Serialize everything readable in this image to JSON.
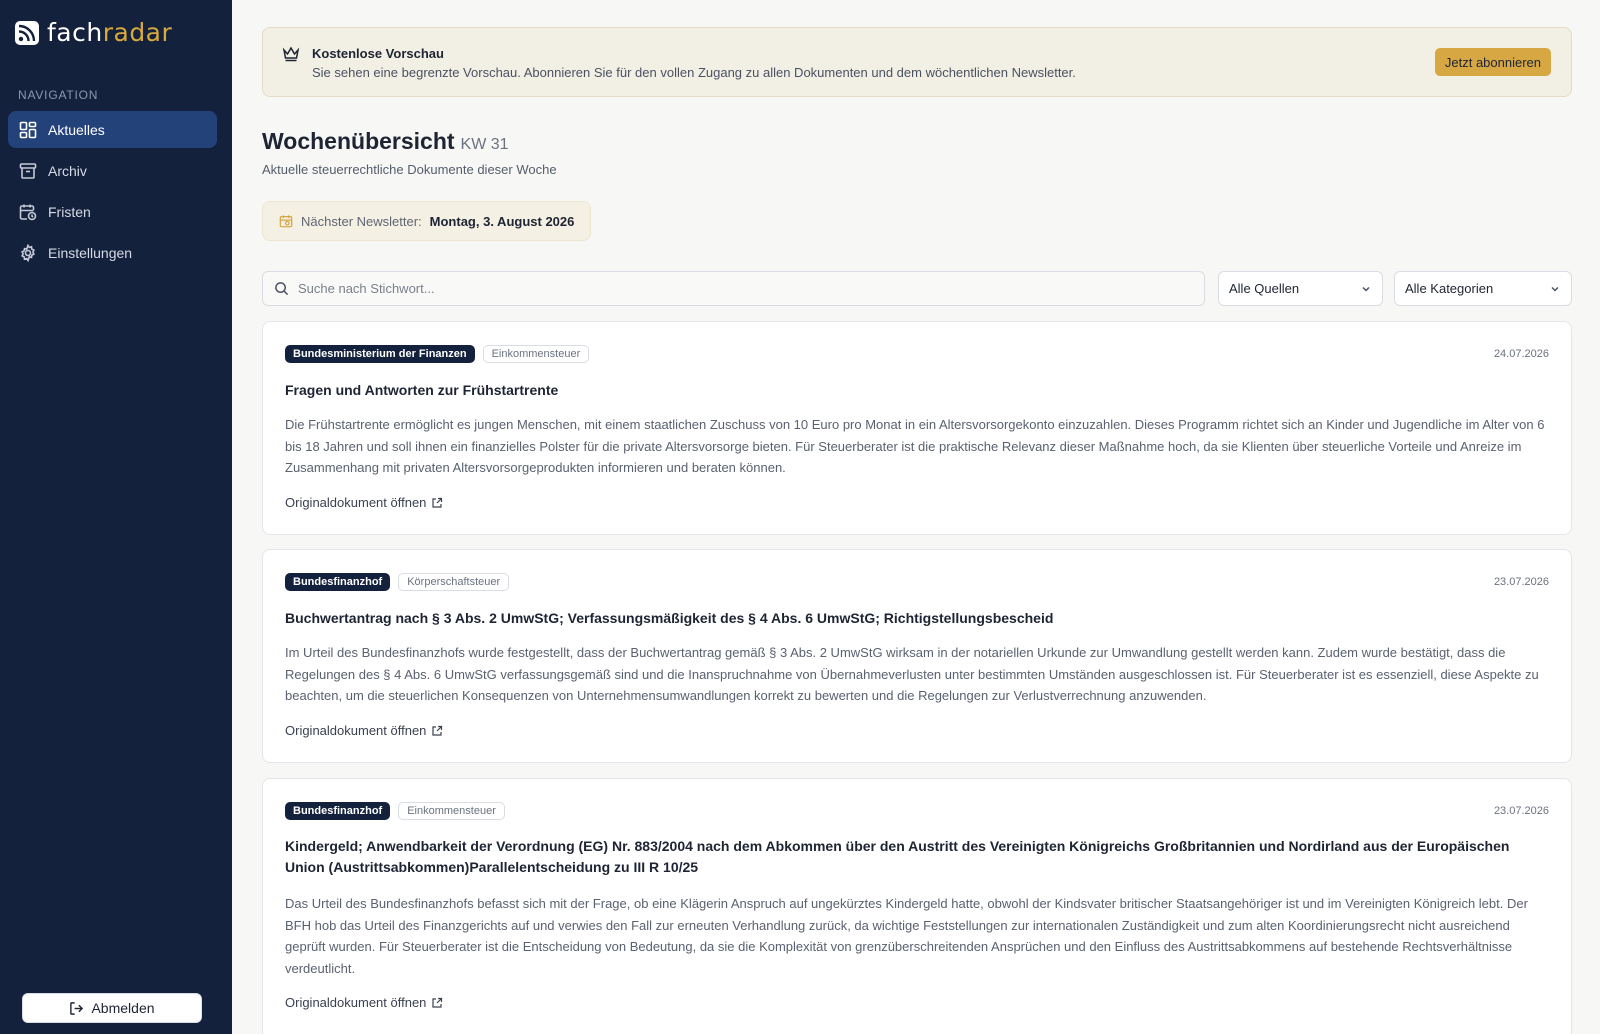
{
  "brand": {
    "name_part1": "fach",
    "name_part2": "radar"
  },
  "sidebar": {
    "heading": "NAVIGATION",
    "items": [
      {
        "label": "Aktuelles",
        "icon": "dashboard-icon",
        "active": true
      },
      {
        "label": "Archiv",
        "icon": "archive-icon",
        "active": false
      },
      {
        "label": "Fristen",
        "icon": "calendar-clock-icon",
        "active": false
      },
      {
        "label": "Einstellungen",
        "icon": "gear-icon",
        "active": false
      }
    ],
    "logout_label": "Abmelden"
  },
  "banner": {
    "icon": "crown-icon",
    "title": "Kostenlose Vorschau",
    "text": "Sie sehen eine begrenzte Vorschau. Abonnieren Sie für den vollen Zugang zu allen Dokumenten und dem wöchentlichen Newsletter.",
    "button_label": "Jetzt abonnieren"
  },
  "page": {
    "title": "Wochenübersicht",
    "week": "KW 31",
    "subtitle": "Aktuelle steuerrechtliche Dokumente dieser Woche"
  },
  "newsletter": {
    "label": "Nächster Newsletter:",
    "date": "Montag, 3. August 2026"
  },
  "filters": {
    "search_placeholder": "Suche nach Stichwort...",
    "source_selected": "Alle Quellen",
    "category_selected": "Alle Kategorien"
  },
  "documents": [
    {
      "source": "Bundesministerium der Finanzen",
      "category": "Einkommensteuer",
      "date": "24.07.2026",
      "title": "Fragen und Antworten zur Frühstartrente",
      "summary": "Die Frühstartrente ermöglicht es jungen Menschen, mit einem staatlichen Zuschuss von 10 Euro pro Monat in ein Altersvorsorgekonto einzuzahlen. Dieses Programm richtet sich an Kinder und Jugendliche im Alter von 6 bis 18 Jahren und soll ihnen ein finanzielles Polster für die private Altersvorsorge bieten. Für Steuerberater ist die praktische Relevanz dieser Maßnahme hoch, da sie Klienten über steuerliche Vorteile und Anreize im Zusammenhang mit privaten Altersvorsorgeprodukten informieren und beraten können.",
      "link_label": "Originaldokument öffnen"
    },
    {
      "source": "Bundesfinanzhof",
      "category": "Körperschaftsteuer",
      "date": "23.07.2026",
      "title": "Buchwertantrag nach § 3 Abs. 2 UmwStG; Verfassungsmäßigkeit des § 4 Abs. 6 UmwStG; Richtigstellungsbescheid",
      "summary": "Im Urteil des Bundesfinanzhofs wurde festgestellt, dass der Buchwertantrag gemäß § 3 Abs. 2 UmwStG wirksam in der notariellen Urkunde zur Umwandlung gestellt werden kann. Zudem wurde bestätigt, dass die Regelungen des § 4 Abs. 6 UmwStG verfassungsgemäß sind und die Inanspruchnahme von Übernahmeverlusten unter bestimmten Umständen ausgeschlossen ist. Für Steuerberater ist es essenziell, diese Aspekte zu beachten, um die steuerlichen Konsequenzen von Unternehmensumwandlungen korrekt zu bewerten und die Regelungen zur Verlustverrechnung anzuwenden.",
      "link_label": "Originaldokument öffnen"
    },
    {
      "source": "Bundesfinanzhof",
      "category": "Einkommensteuer",
      "date": "23.07.2026",
      "title": "Kindergeld; Anwendbarkeit der Verordnung (EG) Nr. 883/2004 nach dem Abkommen über den Austritt des Vereinigten Königreichs Großbritannien und Nordirland aus der Europäischen Union (Austrittsabkommen)Parallelentscheidung zu III R 10/25",
      "summary": "Das Urteil des Bundesfinanzhofs befasst sich mit der Frage, ob eine Klägerin Anspruch auf ungekürztes Kindergeld hatte, obwohl der Kindsvater britischer Staatsangehöriger ist und im Vereinigten Königreich lebt. Der BFH hob das Urteil des Finanzgerichts auf und verwies den Fall zur erneuten Verhandlung zurück, da wichtige Feststellungen zur internationalen Zuständigkeit und zum alten Koordinierungsrecht nicht ausreichend geprüft wurden. Für Steuerberater ist die Entscheidung von Bedeutung, da sie die Komplexität von grenzüberschreitenden Ansprüchen und den Einfluss des Austrittsabkommens auf bestehende Rechtsverhältnisse verdeutlicht.",
      "link_label": "Originaldokument öffnen"
    }
  ]
}
